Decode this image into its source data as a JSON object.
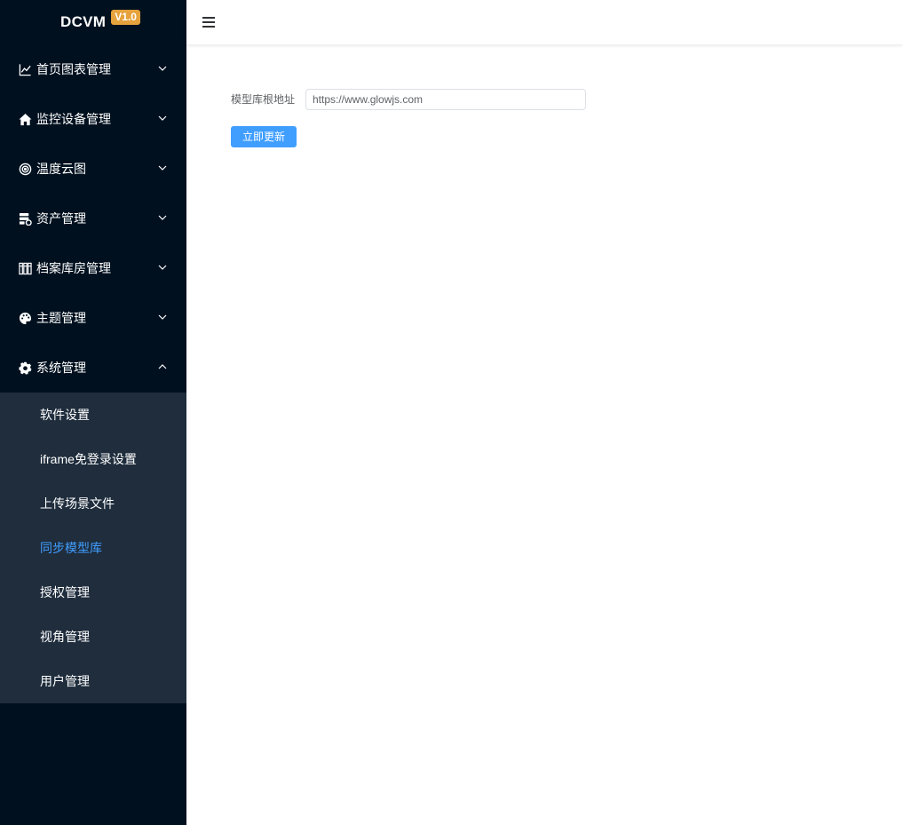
{
  "app": {
    "logo_text": "DCVM",
    "version": "V1.0"
  },
  "sidebar": {
    "items": [
      {
        "label": "首页图表管理",
        "icon": "line-chart-icon",
        "expanded": false
      },
      {
        "label": "监控设备管理",
        "icon": "home-icon",
        "expanded": false
      },
      {
        "label": "温度云图",
        "icon": "target-icon",
        "expanded": false
      },
      {
        "label": "资产管理",
        "icon": "server-settings-icon",
        "expanded": false
      },
      {
        "label": "档案库房管理",
        "icon": "archive-shelf-icon",
        "expanded": false
      },
      {
        "label": "主题管理",
        "icon": "palette-icon",
        "expanded": false
      },
      {
        "label": "系统管理",
        "icon": "gear-icon",
        "expanded": true
      }
    ],
    "system_submenu": [
      {
        "label": "软件设置",
        "active": false
      },
      {
        "label": "iframe免登录设置",
        "active": false
      },
      {
        "label": "上传场景文件",
        "active": false
      },
      {
        "label": "同步模型库",
        "active": true
      },
      {
        "label": "授权管理",
        "active": false
      },
      {
        "label": "视角管理",
        "active": false
      },
      {
        "label": "用户管理",
        "active": false
      }
    ]
  },
  "header": {
    "menu_toggle_icon": "hamburger-icon"
  },
  "form": {
    "label": "模型库根地址",
    "value": "https://www.glowjs.com",
    "submit_label": "立即更新"
  },
  "colors": {
    "sidebar_bg": "#00101f",
    "submenu_bg": "#1f2d3d",
    "accent": "#409eff",
    "badge": "#e6a23c"
  }
}
